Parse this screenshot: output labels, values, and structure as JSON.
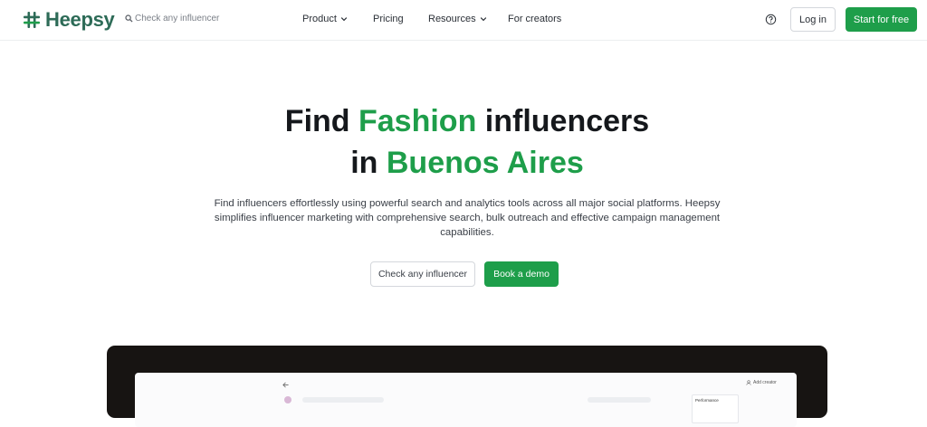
{
  "header": {
    "logo": {
      "text": "Heepsy",
      "icon": "hash-logo-icon",
      "color": "#2d6b57"
    },
    "search": {
      "placeholder": "Check any influencer",
      "icon": "search-icon"
    },
    "nav": [
      {
        "label": "Product",
        "has_dropdown": true
      },
      {
        "label": "Pricing",
        "has_dropdown": false
      },
      {
        "label": "Resources",
        "has_dropdown": true
      },
      {
        "label": "For creators",
        "has_dropdown": false
      }
    ],
    "help_icon": "question-circle-icon",
    "login_label": "Log in",
    "start_label": "Start for free"
  },
  "hero": {
    "title_line1": {
      "pre": "Find ",
      "highlight": "Fashion",
      "post": " influencers"
    },
    "title_line2": {
      "pre": "in ",
      "highlight": "Buenos Aires"
    },
    "description": "Find influencers effortlessly using powerful search and analytics tools across all major social platforms. Heepsy simplifies influencer marketing with comprehensive search, bulk outreach and effective campaign management capabilities.",
    "check_label": "Check any influencer",
    "demo_label": "Book a demo"
  },
  "preview": {
    "add_creator": "Add creator",
    "performance": "Performance"
  },
  "colors": {
    "accent": "#1e9e4a",
    "brand": "#2d6b57",
    "text": "#15181c",
    "device_frame": "#171412"
  }
}
